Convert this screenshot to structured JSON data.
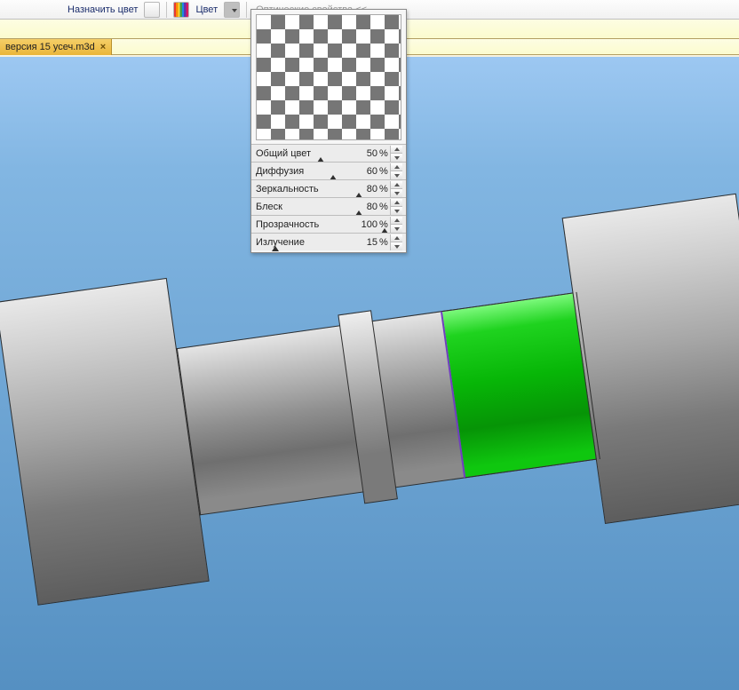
{
  "toolbar": {
    "assign_color_label": "Назначить цвет",
    "color_label": "Цвет",
    "optical_props_label": "Оптические свойства  <<"
  },
  "doc_tab": {
    "name": "версия 15 усеч.m3d",
    "close": "×"
  },
  "panel": {
    "rows": [
      {
        "label": "Общий цвет",
        "value": "50",
        "tick_pct": 50
      },
      {
        "label": "Диффузия",
        "value": "60",
        "tick_pct": 60
      },
      {
        "label": "Зеркальность",
        "value": "80",
        "tick_pct": 80
      },
      {
        "label": "Блеск",
        "value": "80",
        "tick_pct": 80
      },
      {
        "label": "Прозрачность",
        "value": "100",
        "tick_pct": 100
      },
      {
        "label": "Излучение",
        "value": "15",
        "tick_pct": 15
      }
    ]
  },
  "scene": {
    "selected_part": "green-sleeve"
  }
}
